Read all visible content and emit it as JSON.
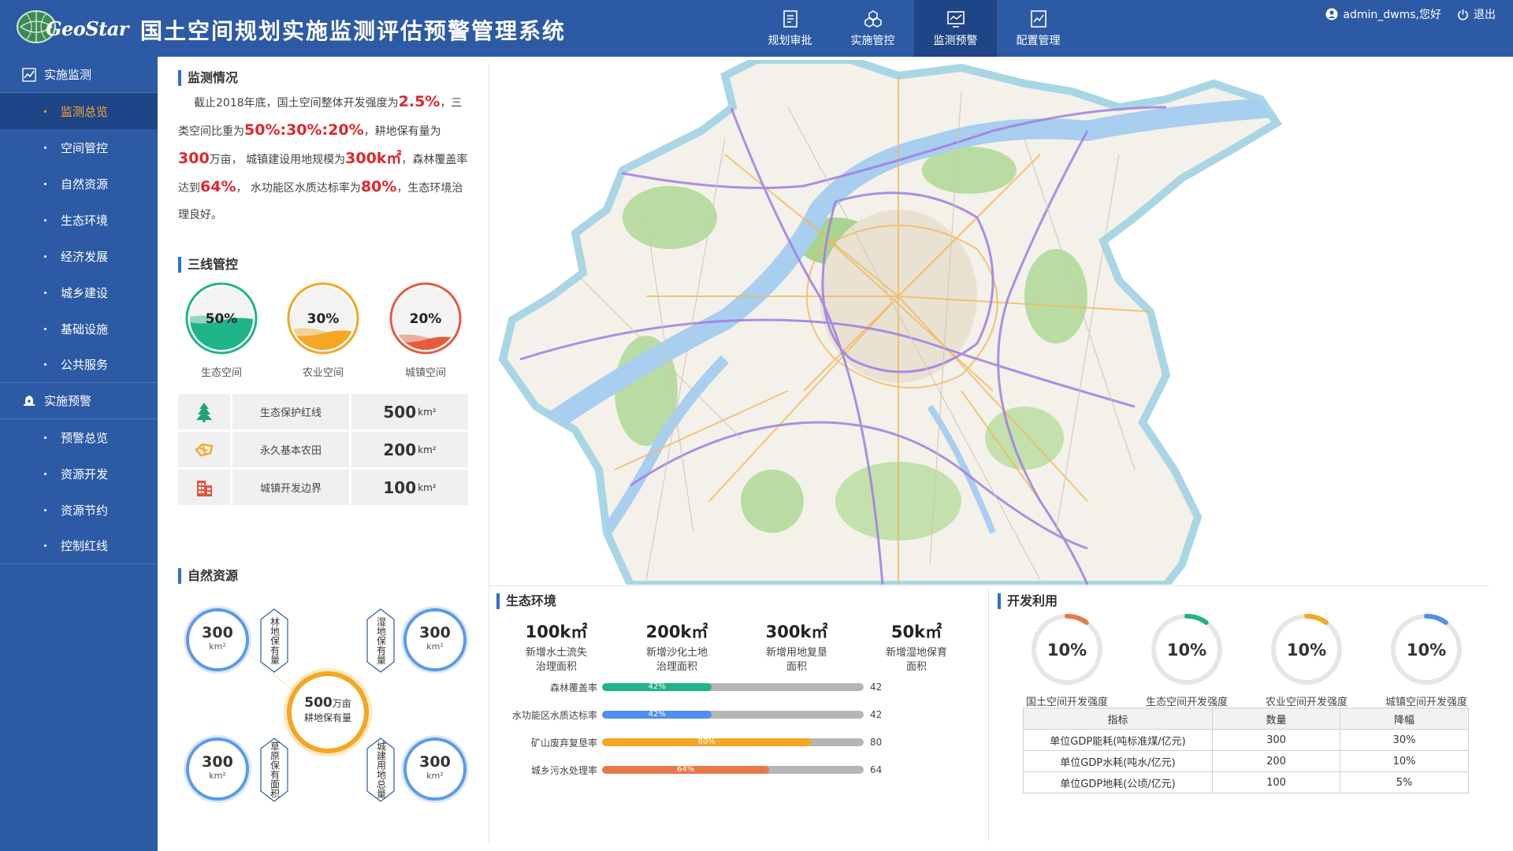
{
  "header": {
    "logo_text": "GeoStar",
    "title": "国土空间规划实施监测评估预警管理系统",
    "nav": [
      {
        "label": "规划审批",
        "icon": "document-icon"
      },
      {
        "label": "实施管控",
        "icon": "cubes-icon"
      },
      {
        "label": "监测预警",
        "icon": "monitor-icon",
        "active": true
      },
      {
        "label": "配置管理",
        "icon": "chart-config-icon"
      }
    ],
    "user": "admin_dwms,您好",
    "logout": "退出"
  },
  "sidebar": {
    "groups": [
      {
        "label": "实施监测",
        "icon": "line-chart-icon",
        "items": [
          "监测总览",
          "空间管控",
          "自然资源",
          "生态环境",
          "经济发展",
          "城乡建设",
          "基础设施",
          "公共服务"
        ]
      },
      {
        "label": "实施预警",
        "icon": "bell-icon",
        "items": [
          "预警总览",
          "资源开发",
          "资源节约",
          "控制红线"
        ]
      }
    ],
    "active_item": "监测总览"
  },
  "monitor": {
    "title": "监测情况",
    "p1": "截止2018年底，国土空间整体开发强度为",
    "v1": "2.5%",
    "p2": "，三类空间比重为",
    "v2": "50%:30%:20%",
    "p3": "，耕地保有量为",
    "v3": "300",
    "p4": "万亩，  城镇建设用地规模为",
    "v4": "300k㎡",
    "p5": "，森林覆盖率达到",
    "v5": "64%",
    "p6": "，  水功能区水质达标率为",
    "v6": "80%",
    "p7": "，生态环境治理良好。"
  },
  "three_lines": {
    "title": "三线管控",
    "gauges": [
      {
        "label": "生态空间",
        "value": "50%",
        "fill": 0.5,
        "color": "#1fb48a",
        "border": "#1fb48a"
      },
      {
        "label": "农业空间",
        "value": "30%",
        "fill": 0.3,
        "color": "#f5a623",
        "border": "#f5a623"
      },
      {
        "label": "城镇空间",
        "value": "20%",
        "fill": 0.2,
        "color": "#e85a3c",
        "border": "#e85a3c"
      }
    ],
    "rows": [
      {
        "name": "生态保护红线",
        "value": "500",
        "unit": "km²",
        "icon": "tree-icon"
      },
      {
        "name": "永久基本农田",
        "value": "200",
        "unit": "km²",
        "icon": "farmland-icon"
      },
      {
        "name": "城镇开发边界",
        "value": "100",
        "unit": "km²",
        "icon": "building-icon"
      }
    ]
  },
  "natural": {
    "title": "自然资源",
    "items": [
      {
        "value": "300",
        "unit": "km²",
        "label": "林地保有量"
      },
      {
        "value": "300",
        "unit": "km²",
        "label": "湿地保有量"
      },
      {
        "value": "300",
        "unit": "km²",
        "label": "草原保有面积"
      },
      {
        "value": "300",
        "unit": "km²",
        "label": "城建用地总量"
      }
    ],
    "center_value": "500",
    "center_unit": "万亩",
    "center_label": "耕地保有量"
  },
  "eco": {
    "title": "生态环境",
    "stats": [
      {
        "value": "100k㎡",
        "line1": "新增水土流失",
        "line2": "治理面积"
      },
      {
        "value": "200k㎡",
        "line1": "新增沙化土地",
        "line2": "治理面积"
      },
      {
        "value": "300k㎡",
        "line1": "新增用地复垦",
        "line2": "面积"
      },
      {
        "value": "50k㎡",
        "line1": "新增湿地保育",
        "line2": "面积"
      }
    ],
    "bars": [
      {
        "label": "森林覆盖率",
        "value": 42,
        "text": "42%",
        "color": "#1fb48a"
      },
      {
        "label": "水功能区水质达标率",
        "value": 42,
        "text": "42%",
        "color": "#4f8ff0"
      },
      {
        "label": "矿山废弃复垦率",
        "value": 80,
        "text": "80%",
        "color": "#f5a623"
      },
      {
        "label": "城乡污水处理率",
        "value": 64,
        "text": "64%",
        "color": "#e8784a"
      }
    ]
  },
  "dev": {
    "title": "开发利用",
    "rings": [
      {
        "label": "国土空间开发强度",
        "value": "10%",
        "fraction": 0.1,
        "color": "#e8784a"
      },
      {
        "label": "生态空间开发强度",
        "value": "10%",
        "fraction": 0.1,
        "color": "#1fb48a"
      },
      {
        "label": "农业空间开发强度",
        "value": "10%",
        "fraction": 0.1,
        "color": "#f5a623"
      },
      {
        "label": "城镇空间开发强度",
        "value": "10%",
        "fraction": 0.1,
        "color": "#4f8ff0"
      }
    ],
    "table": {
      "headers": [
        "指标",
        "数量",
        "降幅"
      ],
      "rows": [
        [
          "单位GDP能耗(吨标准煤/亿元)",
          "300",
          "30%"
        ],
        [
          "单位GDP水耗(吨水/亿元)",
          "200",
          "10%"
        ],
        [
          "单位GDP地耗(公顷/亿元)",
          "100",
          "5%"
        ]
      ]
    }
  }
}
